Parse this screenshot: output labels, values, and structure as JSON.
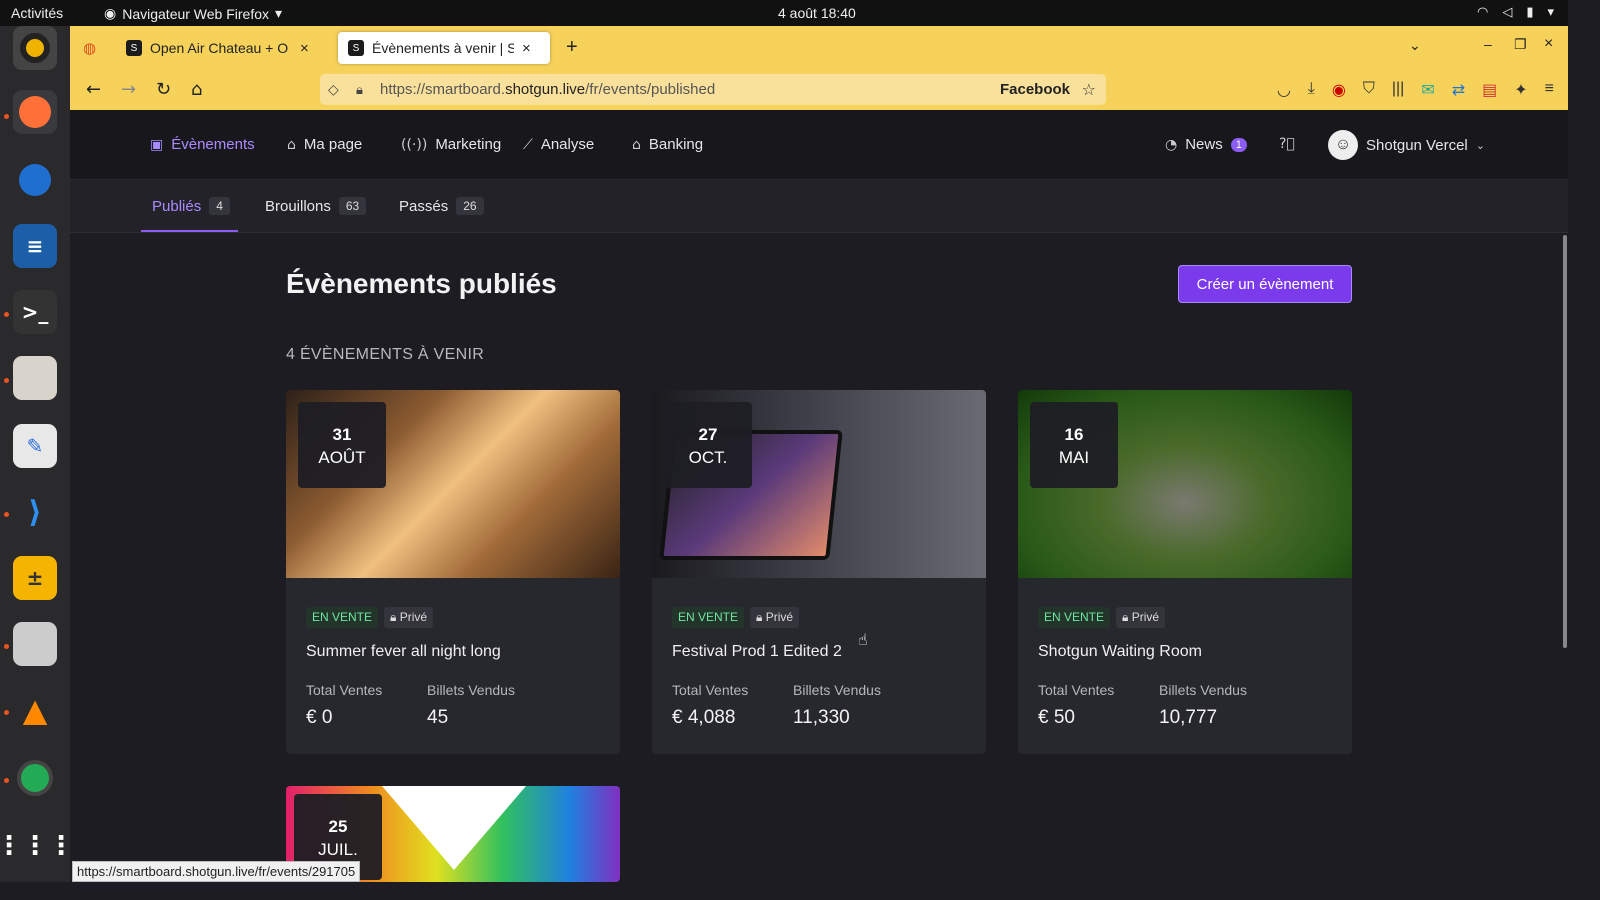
{
  "system_bar": {
    "activities": "Activités",
    "app_name": "Navigateur Web Firefox",
    "clock": "4 août  18:40"
  },
  "browser": {
    "tabs": [
      {
        "title": "Open Air Chateau + O",
        "active": false
      },
      {
        "title": "Évènements à venir | Sho",
        "active": true
      }
    ],
    "url_prefix": "https://smartboard.",
    "url_domain": "shotgun.live",
    "url_path": "/fr/events/published",
    "url_badge": "Facebook",
    "status_url": "https://smartboard.shotgun.live/fr/events/291705"
  },
  "nav": {
    "items": [
      {
        "label": "Évènements",
        "icon": "calendar-icon",
        "active": true
      },
      {
        "label": "Ma page",
        "icon": "home-icon"
      },
      {
        "label": "Marketing",
        "icon": "broadcast-icon"
      },
      {
        "label": "Analyse",
        "icon": "chart-icon"
      },
      {
        "label": "Banking",
        "icon": "bank-icon"
      }
    ],
    "news_label": "News",
    "news_count": "1",
    "user_name": "Shotgun Vercel"
  },
  "subtabs": [
    {
      "label": "Publiés",
      "count": "4",
      "active": true
    },
    {
      "label": "Brouillons",
      "count": "63"
    },
    {
      "label": "Passés",
      "count": "26"
    }
  ],
  "main": {
    "title": "Évènements publiés",
    "create_button": "Créer un évènement",
    "upcoming_heading": "4 ÉVÈNEMENTS À VENIR",
    "stat_label_sales": "Total Ventes",
    "stat_label_tickets": "Billets Vendus",
    "tag_sale": "EN VENTE",
    "tag_private": "Privé"
  },
  "events": [
    {
      "day": "31",
      "month": "AOÛT",
      "name": "Summer fever all night long",
      "total_sales": "€ 0",
      "tickets_sold": "45"
    },
    {
      "day": "27",
      "month": "OCT.",
      "name": "Festival Prod 1 Edited 2",
      "total_sales": "€ 4,088",
      "tickets_sold": "11,330"
    },
    {
      "day": "16",
      "month": "MAI",
      "name": "Shotgun Waiting Room",
      "total_sales": "€ 50",
      "tickets_sold": "10,777"
    },
    {
      "day": "25",
      "month": "JUIL."
    }
  ],
  "colors": {
    "accent": "#8b5cf6",
    "page_bg": "#1c1c22",
    "firefox_toolbar": "#f6d25a"
  }
}
